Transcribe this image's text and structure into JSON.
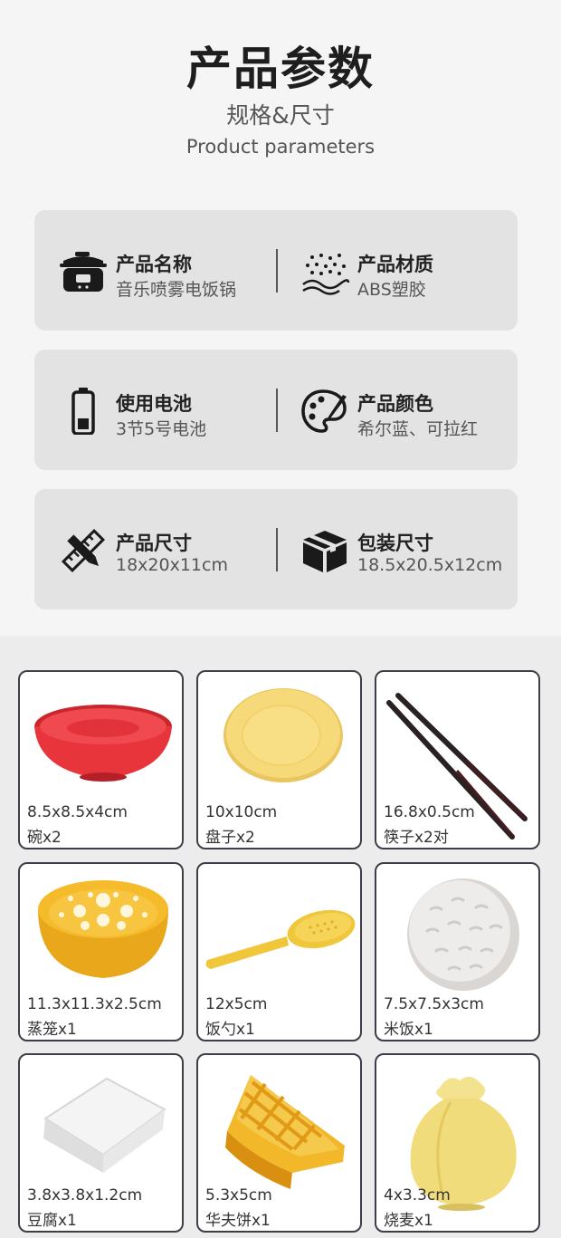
{
  "header": {
    "title": "产品参数",
    "subtitle": "规格&尺寸",
    "subtitle_en": "Product parameters"
  },
  "specs": [
    {
      "left": {
        "icon": "rice-cooker-icon",
        "label": "产品名称",
        "value": "音乐喷雾电饭锅"
      },
      "right": {
        "icon": "material-dots-icon",
        "label": "产品材质",
        "value": "ABS塑胶"
      }
    },
    {
      "left": {
        "icon": "battery-icon",
        "label": "使用电池",
        "value": "3节5号电池"
      },
      "right": {
        "icon": "palette-icon",
        "label": "产品颜色",
        "value": "希尔蓝、可拉红"
      }
    },
    {
      "left": {
        "icon": "ruler-pencil-icon",
        "label": "产品尺寸",
        "value": "18x20x11cm"
      },
      "right": {
        "icon": "package-box-icon",
        "label": "包装尺寸",
        "value": "18.5x20.5x12cm"
      }
    }
  ],
  "parts": [
    {
      "size": "8.5x8.5x4cm",
      "name": "碗x2",
      "image": "red-bowl"
    },
    {
      "size": "10x10cm",
      "name": "盘子x2",
      "image": "yellow-plate"
    },
    {
      "size": "16.8x0.5cm",
      "name": "筷子x2对",
      "image": "chopsticks"
    },
    {
      "size": "11.3x11.3x2.5cm",
      "name": "蒸笼x1",
      "image": "steamer"
    },
    {
      "size": "12x5cm",
      "name": "饭勺x1",
      "image": "rice-spoon"
    },
    {
      "size": "7.5x7.5x3cm",
      "name": "米饭x1",
      "image": "rice-ball"
    },
    {
      "size": "3.8x3.8x1.2cm",
      "name": "豆腐x1",
      "image": "tofu"
    },
    {
      "size": "5.3x5cm",
      "name": "华夫饼x1",
      "image": "waffle"
    },
    {
      "size": "4x3.3cm",
      "name": "烧麦x1",
      "image": "shumai"
    }
  ],
  "colors": {
    "card_bg": "#e3e3e3",
    "bowl_red": "#e8353c",
    "plate_yellow": "#f6da7a",
    "steamer_orange": "#f5bb2a",
    "border": "#3c3f47"
  }
}
